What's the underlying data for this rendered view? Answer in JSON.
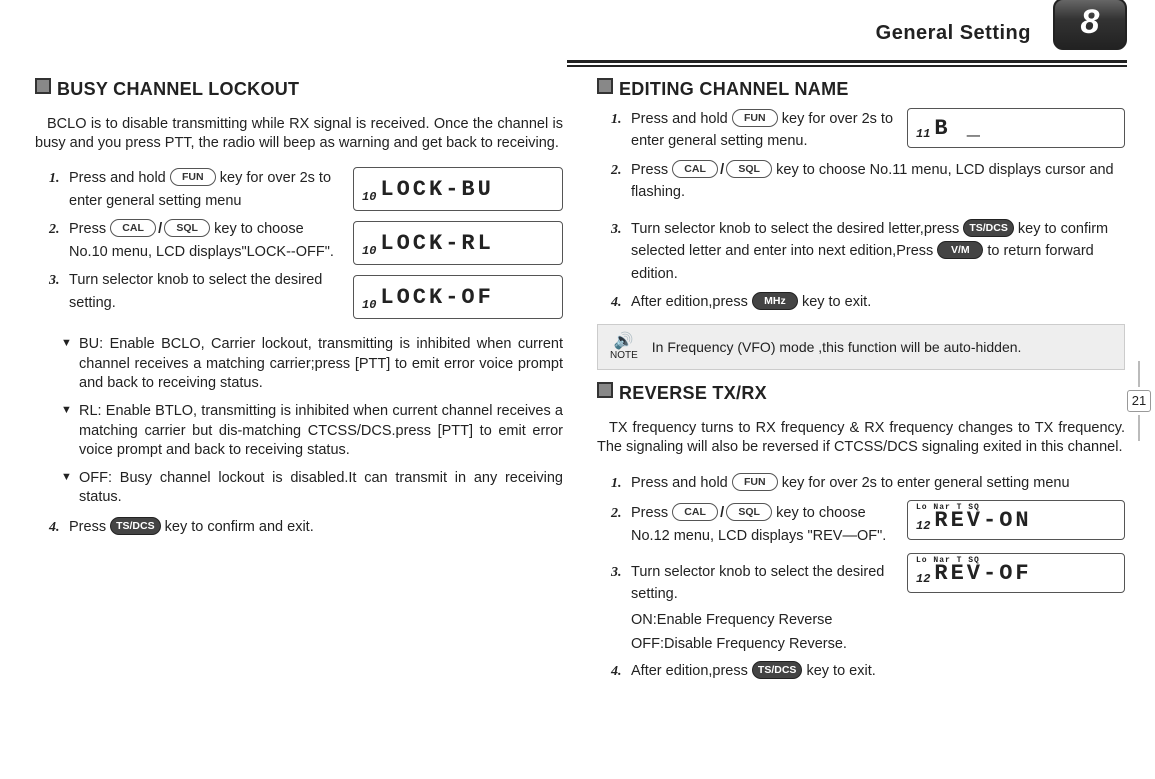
{
  "header": {
    "title": "General Setting",
    "chapter": "8"
  },
  "sidepage": "21",
  "keys": {
    "fun": "FUN",
    "cal": "CAL",
    "sql": "SQL",
    "tsdcs": "TS/DCS",
    "vm": "V/M",
    "mhz": "MHz"
  },
  "left": {
    "bclo": {
      "heading": "BUSY CHANNEL LOCKOUT",
      "intro": "BCLO is to disable transmitting while RX signal is received. Once the channel is busy and you press PTT, the radio will beep as warning and get back to receiving.",
      "steps": {
        "s1a": "Press and hold ",
        "s1b": " key for over 2s to enter general setting menu",
        "s2a": "Press ",
        "s2b": " key to choose No.10 menu, LCD displays\"LOCK--OFF\".",
        "s3": "Turn selector knob to select the desired setting.",
        "s4a": "Press ",
        "s4b": " key to confirm and exit."
      },
      "lcd": {
        "pre": "10",
        "l1": "LOCK-BU",
        "l2": "LOCK-RL",
        "l3": "LOCK-OF"
      },
      "opts": {
        "bu": "BU: Enable BCLO, Carrier lockout, transmitting is inhibited when current channel receives a matching carrier;press [PTT] to emit error voice prompt and back to receiving status.",
        "rl": "RL: Enable BTLO, transmitting is inhibited when current channel receives a matching carrier but dis-matching CTCSS/DCS.press [PTT] to emit error voice prompt and back to receiving status.",
        "off": "OFF: Busy channel lockout is disabled.It can transmit in any receiving status."
      }
    }
  },
  "right": {
    "edit": {
      "heading": "EDITING CHANNEL NAME",
      "lcd": {
        "pre": "11",
        "val": "B _"
      },
      "steps": {
        "s1a": "Press and hold ",
        "s1b": " key for over 2s to enter general setting menu.",
        "s2a": "Press ",
        "s2b": " key to choose No.11 menu, LCD displays cursor and flashing.",
        "s3a": "Turn selector knob to select the desired letter,press ",
        "s3b": " key to confirm selected letter and enter into next edition,Press ",
        "s3c": " to return forward edition.",
        "s4a": "After edition,press ",
        "s4b": " key to exit."
      },
      "note_label": "NOTE",
      "note": "In Frequency (VFO) mode ,this function will be auto-hidden."
    },
    "rev": {
      "heading": "REVERSE TX/RX",
      "intro": "TX frequency turns to RX frequency & RX frequency changes to TX frequency. The signaling will also be reversed if  CTCSS/DCS signaling exited in this channel.",
      "lcd": {
        "pre": "12",
        "top": "Lo Nar    T SQ",
        "l1": "REV-ON",
        "l2": "REV-OF"
      },
      "steps": {
        "s1a": "Press and hold ",
        "s1b": " key for over 2s to enter general setting menu",
        "s2a": "Press ",
        "s2b": " key to choose No.12 menu, LCD displays \"REV—OF\".",
        "s3": "Turn selector knob to select the desired setting.",
        "on": "ON:Enable Frequency Reverse",
        "off": "OFF:Disable Frequency Reverse.",
        "s4a": "After edition,press ",
        "s4b": " key to exit."
      }
    }
  }
}
